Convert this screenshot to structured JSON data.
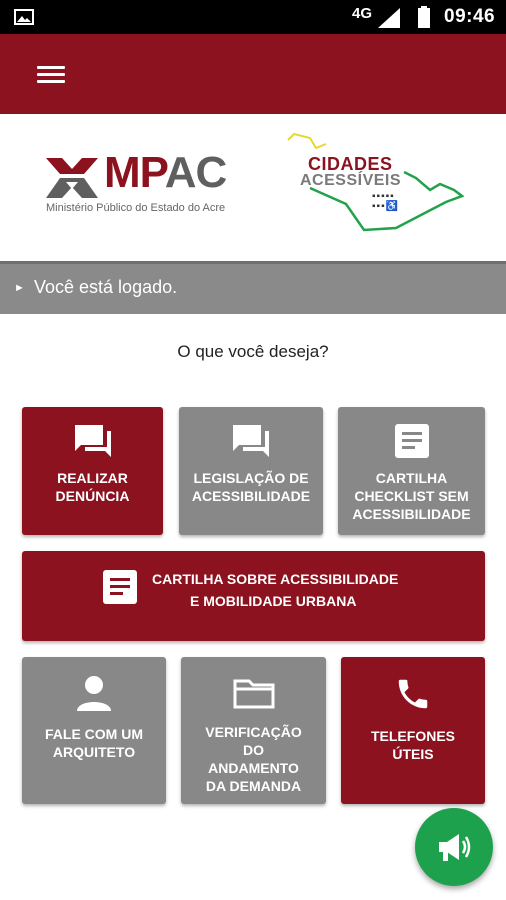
{
  "status_bar": {
    "network": "4G",
    "time": "09:46"
  },
  "logos": {
    "mpac_name_a": "MP",
    "mpac_name_b": "AC",
    "mpac_subtitle": "Ministério Público do Estado do Acre",
    "cidades_line1": "CIDADES",
    "cidades_line2": "ACESSÍVEIS"
  },
  "logged_status": "Você está logado.",
  "question": "O que você deseja?",
  "tiles": [
    {
      "label_1": "REALIZAR",
      "label_2": "DENÚNCIA",
      "color": "#8b121e",
      "icon": "chat-icon"
    },
    {
      "label_1": "LEGISLAÇÃO DE",
      "label_2": "ACESSIBILIDADE",
      "color": "#888888",
      "icon": "chat-icon"
    },
    {
      "label_1": "CARTILHA",
      "label_2": "CHECKLIST SEM",
      "label_3": "ACESSIBILIDADE",
      "color": "#888888",
      "icon": "document-icon"
    },
    {
      "label_1": "CARTILHA SOBRE ACESSIBILIDADE",
      "label_2": "E MOBILIDADE URBANA",
      "color": "#8b121e",
      "icon": "document-icon"
    },
    {
      "label_1": "FALE COM UM",
      "label_2": "ARQUITETO",
      "color": "#888888",
      "icon": "person-icon"
    },
    {
      "label_1": "VERIFICAÇÃO",
      "label_2": "DO",
      "label_3": "ANDAMENTO",
      "label_4": "DA DEMANDA",
      "color": "#888888",
      "icon": "folder-icon"
    },
    {
      "label_1": "TELEFONES",
      "label_2": "ÚTEIS",
      "color": "#8b121e",
      "icon": "phone-icon"
    }
  ],
  "fab": {
    "icon": "megaphone-icon",
    "color": "#1ea14d"
  },
  "colors": {
    "primary": "#8b121e",
    "secondary": "#888888",
    "accent": "#1ea14d"
  }
}
